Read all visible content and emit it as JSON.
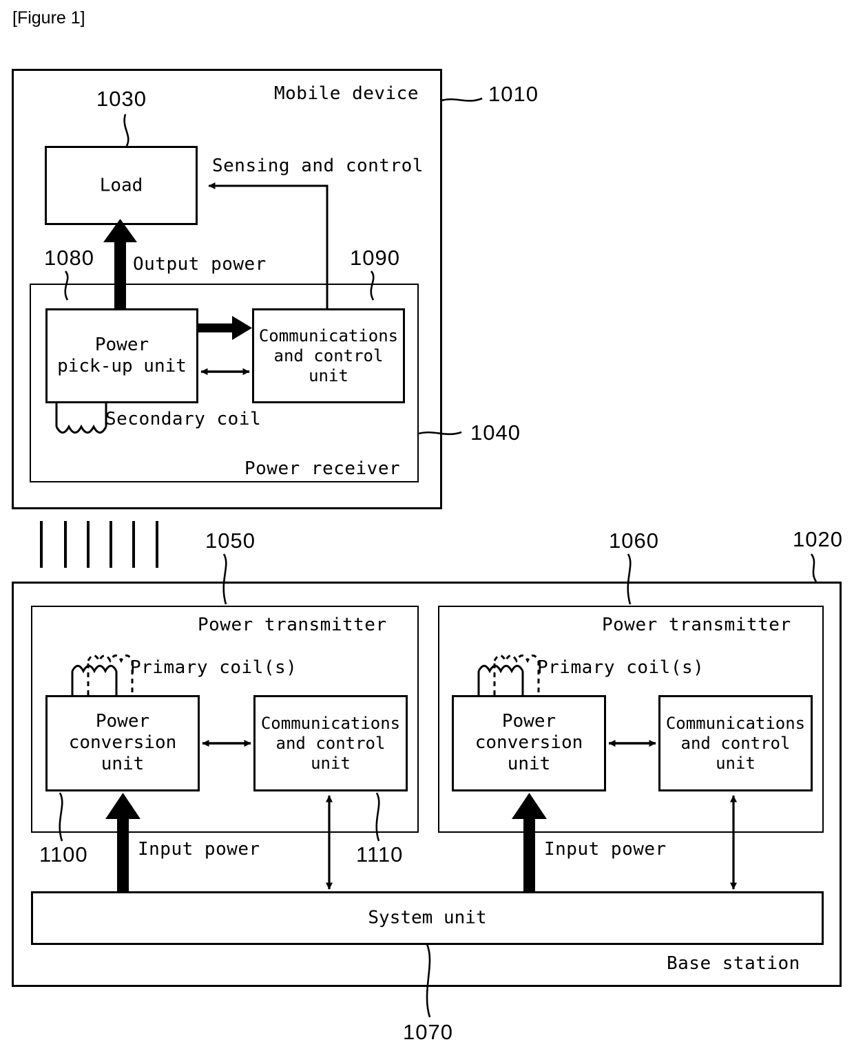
{
  "figure": {
    "title": "[Figure 1]"
  },
  "mobile_device": {
    "title": "Mobile device",
    "ref": "1010",
    "load": {
      "label": "Load",
      "ref": "1030"
    },
    "sensing_and_control_label": "Sensing and control",
    "output_power_label": "Output power",
    "power_receiver": {
      "title": "Power receiver",
      "ref": "1040",
      "power_pickup_unit": {
        "line1": "Power",
        "line2": "pick-up unit",
        "ref": "1080"
      },
      "communications_unit": {
        "line1": "Communications",
        "line2": "and control unit",
        "ref": "1090"
      },
      "secondary_coil_label": "Secondary coil"
    }
  },
  "base_station": {
    "title": "Base station",
    "ref": "1020",
    "system_unit": {
      "label": "System unit",
      "ref": "1070"
    },
    "transmitters": [
      {
        "title": "Power transmitter",
        "ref": "1050",
        "primary_coil_label": "Primary coil(s)",
        "power_conversion_unit": {
          "line1": "Power",
          "line2": "conversion unit",
          "ref": "1100"
        },
        "communications_unit": {
          "line1": "Communications",
          "line2": "and control unit",
          "ref": "1110"
        },
        "input_power_label": "Input power"
      },
      {
        "title": "Power transmitter",
        "ref": "1060",
        "primary_coil_label": "Primary coil(s)",
        "power_conversion_unit": {
          "line1": "Power",
          "line2": "conversion unit",
          "ref": ""
        },
        "communications_unit": {
          "line1": "Communications",
          "line2": "and control unit",
          "ref": ""
        },
        "input_power_label": "Input power"
      }
    ]
  },
  "colors": {
    "stroke": "#000000",
    "background": "#ffffff"
  }
}
